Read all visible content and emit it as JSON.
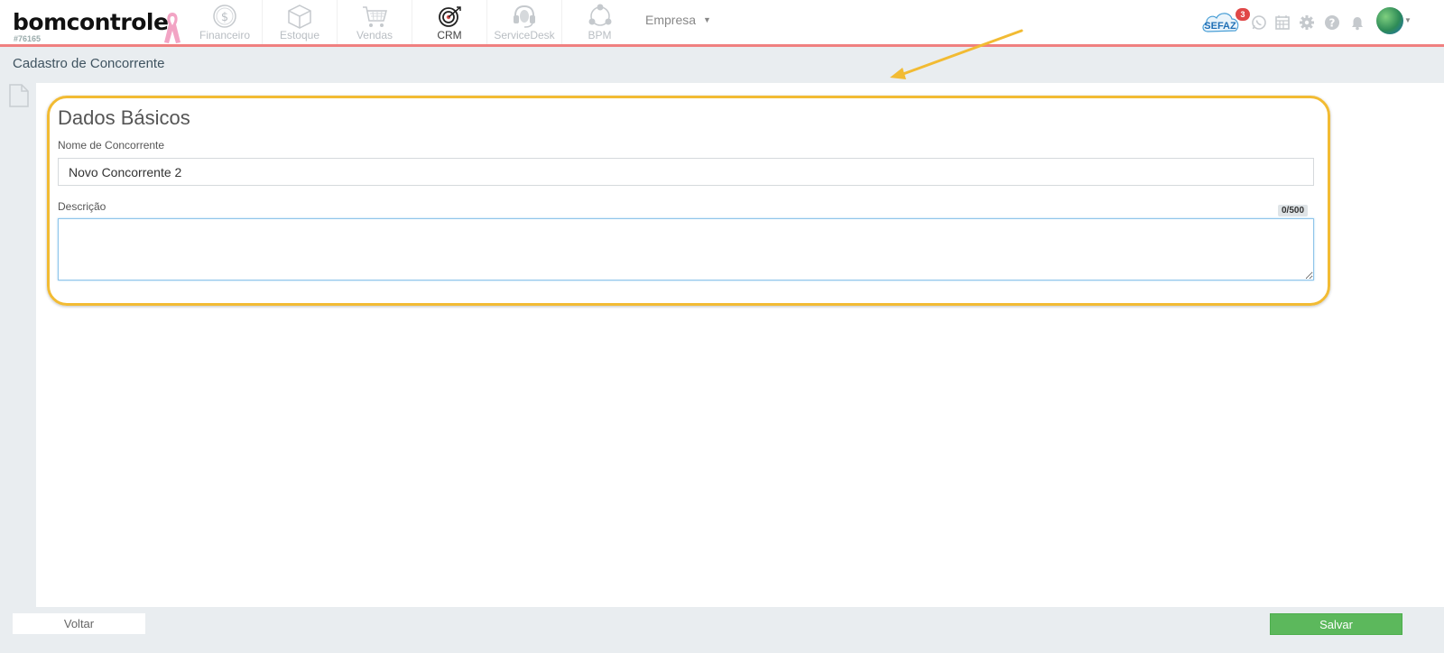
{
  "brand": {
    "name": "bomcontrole",
    "account_code": "#76165"
  },
  "nav": {
    "modules": [
      {
        "label": "Financeiro",
        "icon": "dollar-coin-icon",
        "active": false
      },
      {
        "label": "Estoque",
        "icon": "box-icon",
        "active": false
      },
      {
        "label": "Vendas",
        "icon": "shopping-cart-icon",
        "active": false
      },
      {
        "label": "CRM",
        "icon": "target-icon",
        "active": true
      },
      {
        "label": "ServiceDesk",
        "icon": "headset-icon",
        "active": false
      },
      {
        "label": "BPM",
        "icon": "process-cycle-icon",
        "active": false
      }
    ],
    "company_selector": "Empresa"
  },
  "header_right": {
    "sefaz_label": "SEFAZ",
    "sefaz_badge": "3",
    "icons": [
      "whatsapp-icon",
      "calendar-icon",
      "gear-icon",
      "help-icon",
      "bell-icon"
    ]
  },
  "page": {
    "title": "Cadastro de Concorrente"
  },
  "form": {
    "section_title": "Dados Básicos",
    "name_label": "Nome de Concorrente",
    "name_value": "Novo Concorrente 2",
    "description_label": "Descrição",
    "description_value": "",
    "description_counter": "0/500"
  },
  "footer": {
    "back_label": "Voltar",
    "save_label": "Salvar"
  },
  "colors": {
    "header_border": "#f08080",
    "highlight": "#f2bb33",
    "save_button": "#5cb85c",
    "background": "#e9edf0"
  }
}
